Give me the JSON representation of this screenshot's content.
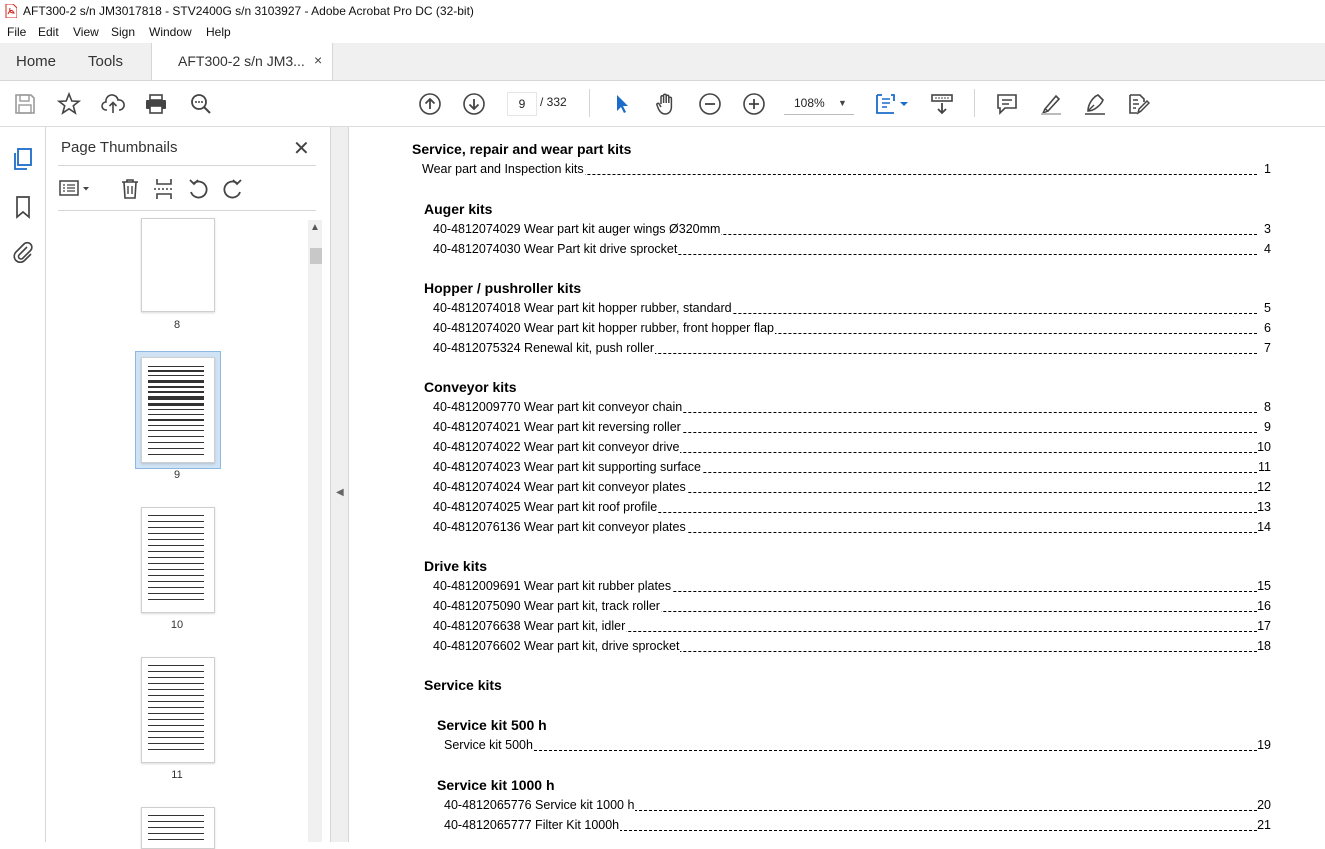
{
  "window": {
    "title": "AFT300-2  s/n JM3017818 - STV2400G s/n 3103927 - Adobe Acrobat Pro DC (32-bit)"
  },
  "menu": {
    "items": [
      "File",
      "Edit",
      "View",
      "Sign",
      "Window",
      "Help"
    ]
  },
  "tabs": {
    "home": "Home",
    "tools": "Tools",
    "document": "AFT300-2  s/n JM3...",
    "close": "×"
  },
  "toolbar": {
    "page_current": "9",
    "page_total": "/  332",
    "zoom": "108%"
  },
  "thumbnails": {
    "title": "Page Thumbnails",
    "close": "✕",
    "pages": [
      "8",
      "9",
      "10",
      "11"
    ],
    "selected": "9"
  },
  "document": {
    "heading": "Service, repair and wear part kits",
    "intro": {
      "text": "Wear part and Inspection kits",
      "page": "1"
    },
    "sections": [
      {
        "title": "Auger kits",
        "entries": [
          {
            "text": "40-4812074029 Wear part kit auger wings Ø320mm",
            "page": "3"
          },
          {
            "text": "40-4812074030 Wear Part kit drive sprocket",
            "page": "4"
          }
        ]
      },
      {
        "title": "Hopper / pushroller kits",
        "entries": [
          {
            "text": "40-4812074018 Wear part kit hopper rubber, standard",
            "page": "5"
          },
          {
            "text": "40-4812074020 Wear part kit hopper rubber, front hopper flap",
            "page": "6"
          },
          {
            "text": "40-4812075324 Renewal kit, push roller",
            "page": "7"
          }
        ]
      },
      {
        "title": "Conveyor kits",
        "entries": [
          {
            "text": "40-4812009770 Wear part kit conveyor chain",
            "page": "8"
          },
          {
            "text": "40-4812074021 Wear part kit reversing roller",
            "page": "9"
          },
          {
            "text": "40-4812074022 Wear part kit conveyor drive",
            "page": "10"
          },
          {
            "text": "40-4812074023 Wear part kit supporting surface",
            "page": "11"
          },
          {
            "text": "40-4812074024 Wear part kit conveyor plates",
            "page": "12"
          },
          {
            "text": "40-4812074025 Wear part kit roof profile",
            "page": "13"
          },
          {
            "text": "40-4812076136 Wear part kit conveyor plates",
            "page": "14"
          }
        ]
      },
      {
        "title": "Drive kits",
        "entries": [
          {
            "text": "40-4812009691 Wear part kit rubber plates",
            "page": "15"
          },
          {
            "text": "40-4812075090 Wear part kit, track roller",
            "page": "16"
          },
          {
            "text": "40-4812076638 Wear part kit, idler",
            "page": "17"
          },
          {
            "text": "40-4812076602 Wear part kit, drive sprocket",
            "page": "18"
          }
        ]
      },
      {
        "title": "Service kits",
        "entries": []
      }
    ],
    "service": [
      {
        "title": "Service kit 500 h",
        "entries": [
          {
            "text": "Service kit 500h",
            "page": "19"
          }
        ]
      },
      {
        "title": "Service kit 1000 h",
        "entries": [
          {
            "text": "40-4812065776 Service kit 1000 h",
            "page": "20"
          },
          {
            "text": "40-4812065777 Filter Kit 1000h",
            "page": "21"
          }
        ]
      }
    ]
  }
}
